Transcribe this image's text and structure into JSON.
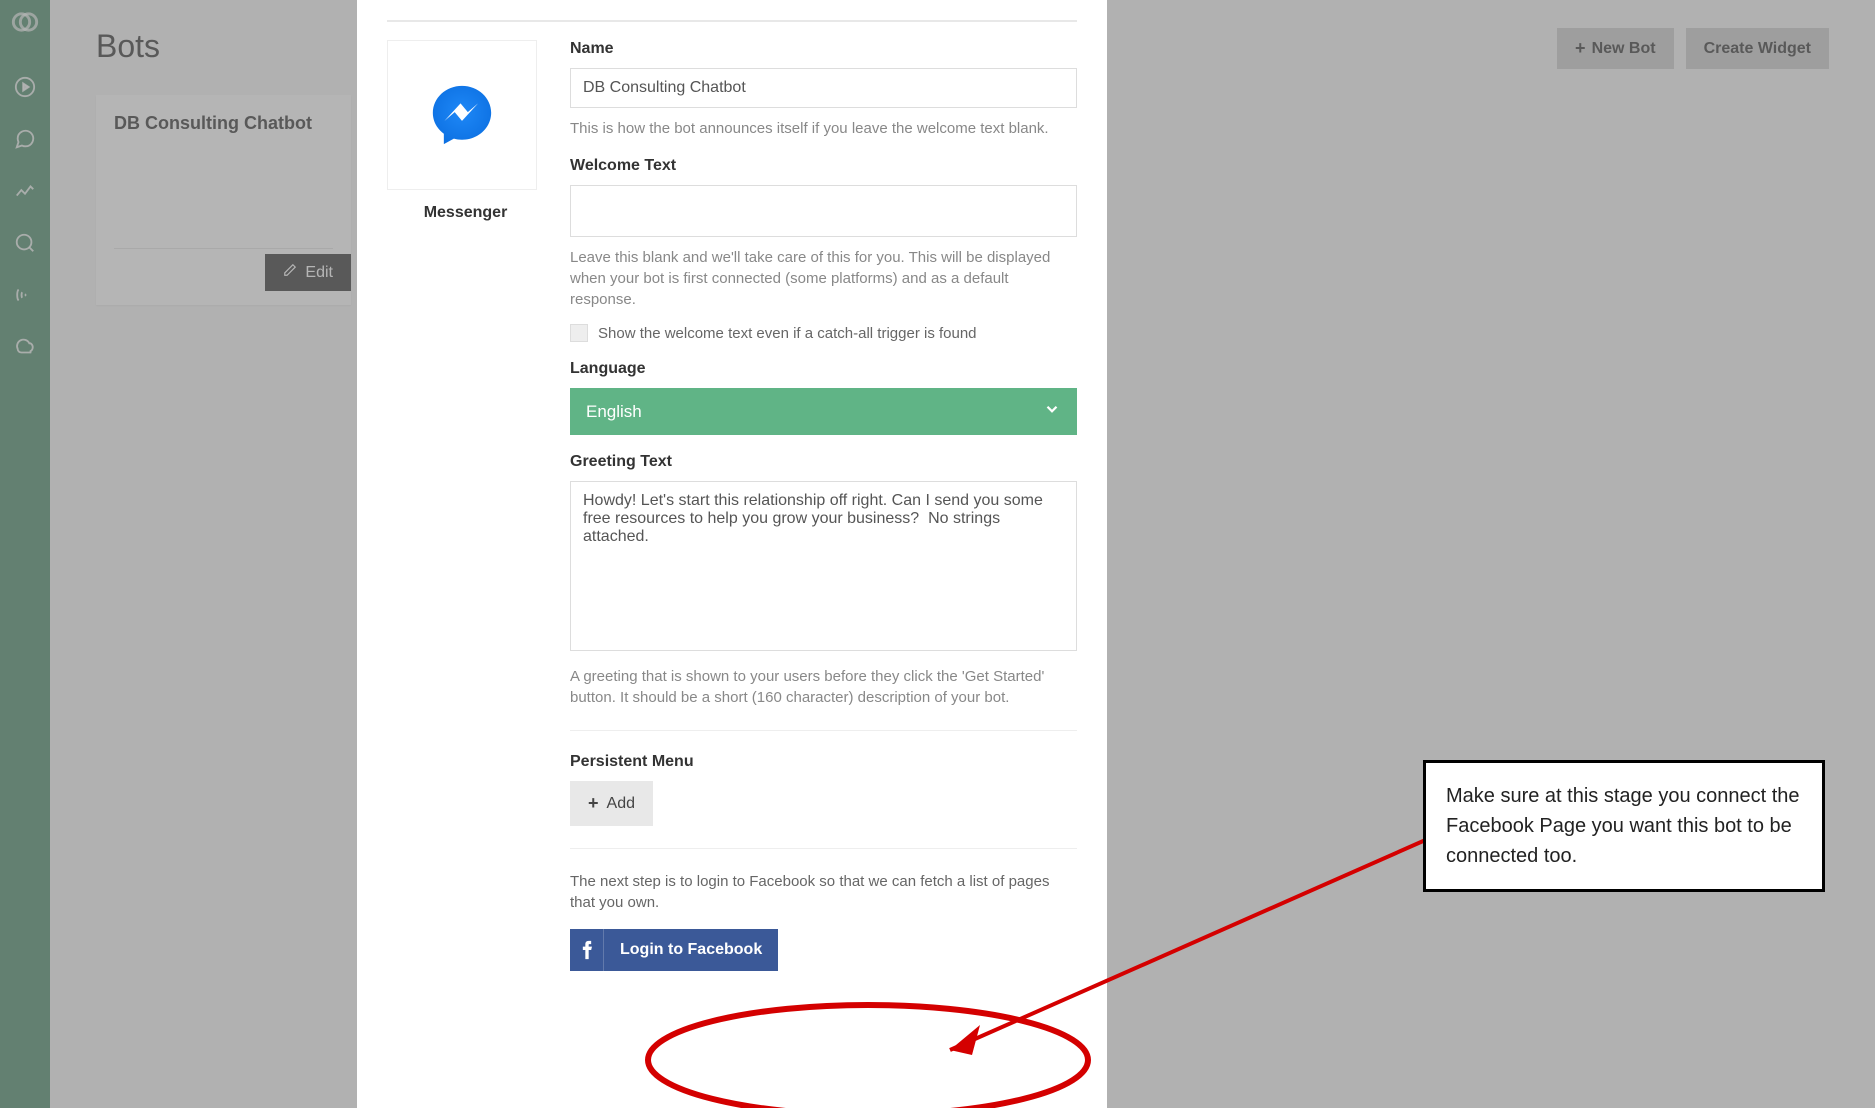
{
  "page": {
    "title": "Bots",
    "new_bot": "New Bot",
    "create_widget": "Create Widget"
  },
  "bot_card": {
    "name": "DB Consulting Chatbot",
    "edit": "Edit"
  },
  "modal": {
    "platform_label": "Messenger",
    "name_label": "Name",
    "name_value": "DB Consulting Chatbot",
    "name_help": "This is how the bot announces itself if you leave the welcome text blank.",
    "welcome_label": "Welcome Text",
    "welcome_value": "",
    "welcome_help": "Leave this blank and we'll take care of this for you. This will be displayed when your bot is first connected (some platforms) and as a default response.",
    "show_welcome_checkbox": "Show the welcome text even if a catch-all trigger is found",
    "language_label": "Language",
    "language_value": "English",
    "greeting_label": "Greeting Text",
    "greeting_value": "Howdy! Let's start this relationship off right. Can I send you some free resources to help you grow your business?  No strings attached.",
    "greeting_help": "A greeting that is shown to your users before they click the 'Get Started' button. It should be a short (160 character) description of your bot.",
    "persistent_menu_label": "Persistent Menu",
    "add_button": "Add",
    "next_step_text": "The next step is to login to Facebook so that we can fetch a list of pages that you own.",
    "login_fb": "Login to Facebook"
  },
  "callout": {
    "text": "Make sure at this stage you connect the Facebook Page you want this bot to be connected too."
  }
}
